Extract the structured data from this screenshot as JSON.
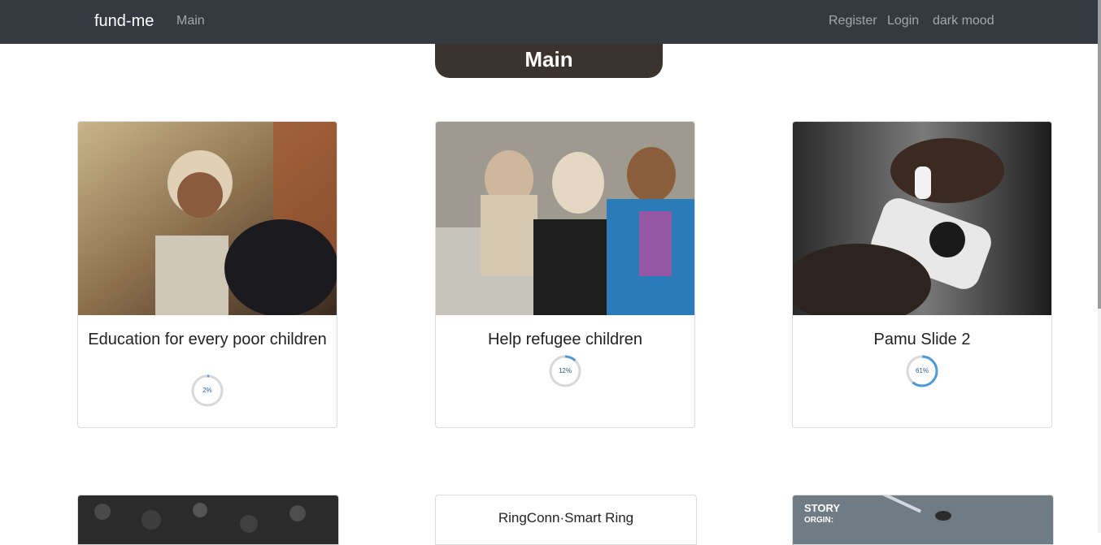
{
  "navbar": {
    "brand": "fund-me",
    "links": [
      "Main",
      "Register",
      "Login",
      "dark mood"
    ]
  },
  "banner": {
    "title": "Main"
  },
  "cards": [
    {
      "title": "Education for every poor children",
      "progress_label": "2%",
      "progress": 0.02
    },
    {
      "title": "Help refugee children",
      "progress_label": "12%",
      "progress": 0.12
    },
    {
      "title": "Pamu Slide 2",
      "progress_label": "61%",
      "progress": 0.61
    }
  ],
  "bottom_cards": {
    "ringconn": "RingConn·Smart Ring",
    "story_line1": "STORY",
    "story_line2": "ORGIN:"
  },
  "colors": {
    "navbar_bg": "#343a40",
    "banner_bg": "#3b342e",
    "progress_track": "#d8d8d8",
    "progress_fill": "#4f9bd6"
  }
}
